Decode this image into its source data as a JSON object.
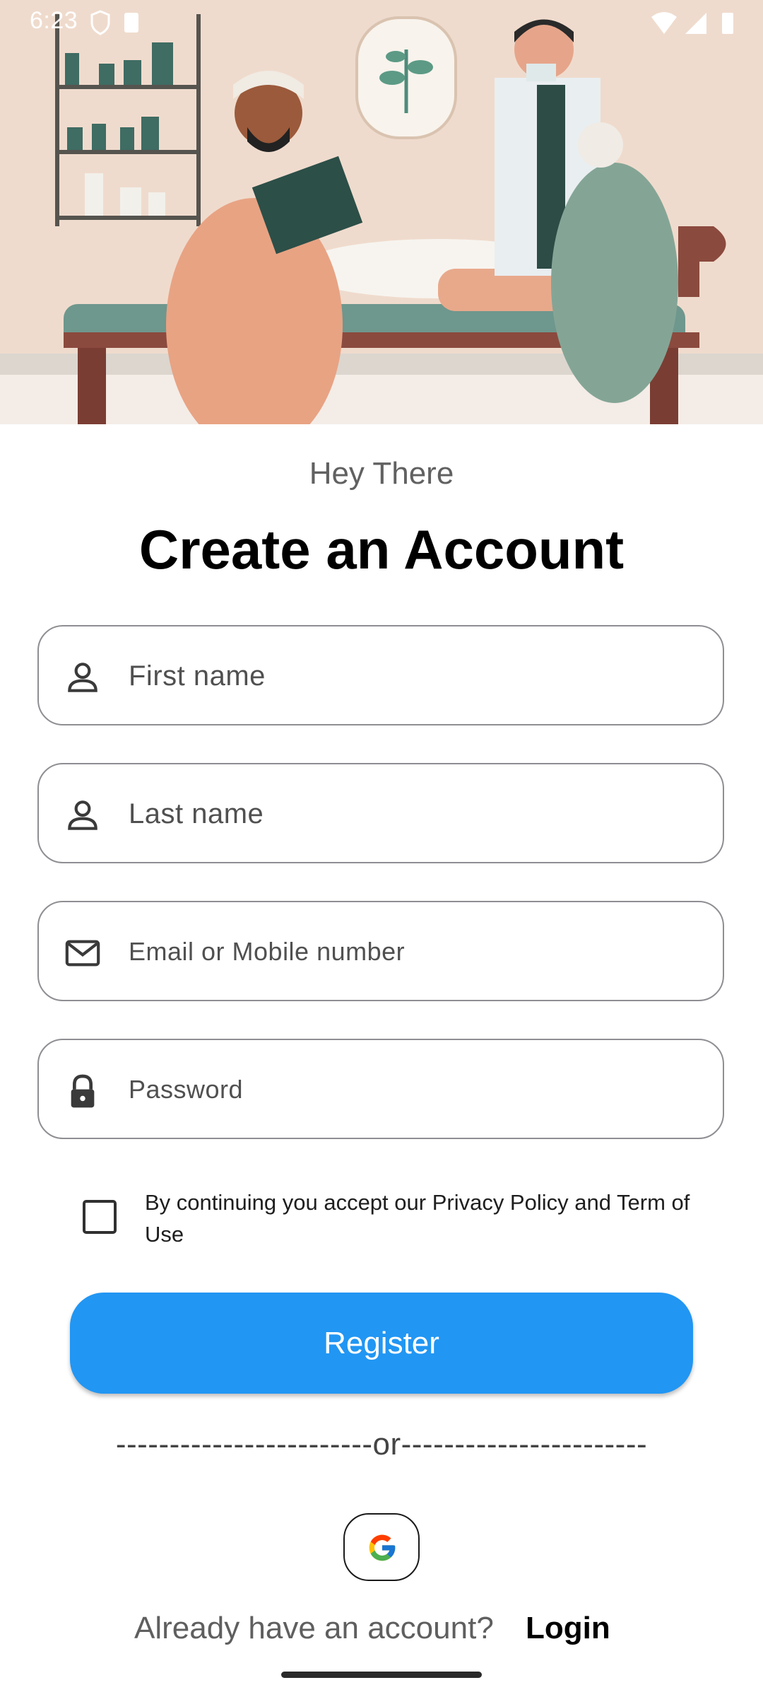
{
  "status_bar": {
    "time": "6:23",
    "left_icons": [
      "shield-icon",
      "sd-card-icon"
    ],
    "right_icons": [
      "wifi-icon",
      "signal-icon",
      "battery-icon"
    ]
  },
  "hero": {
    "description_icon": "medical-examination-illustration"
  },
  "header": {
    "greeting": "Hey There",
    "title": "Create an Account"
  },
  "form": {
    "first_name": {
      "placeholder": "First name",
      "icon": "person-icon"
    },
    "last_name": {
      "placeholder": "Last name",
      "icon": "person-icon"
    },
    "email": {
      "placeholder": "Email or Mobile number",
      "icon": "mail-icon"
    },
    "password": {
      "placeholder": "Password",
      "icon": "lock-icon"
    },
    "terms": {
      "checked": false,
      "label": "By continuing you accept our Privacy Policy and Term of Use"
    },
    "register_label": "Register"
  },
  "divider": {
    "text": "------------------------or-----------------------"
  },
  "social": {
    "google_icon": "google-icon"
  },
  "footer": {
    "prompt": "Already have an account?",
    "login_label": "Login"
  },
  "colors": {
    "accent": "#2196f3",
    "field_border": "#8e8e93",
    "text_primary": "#000000",
    "text_secondary": "#616161"
  }
}
